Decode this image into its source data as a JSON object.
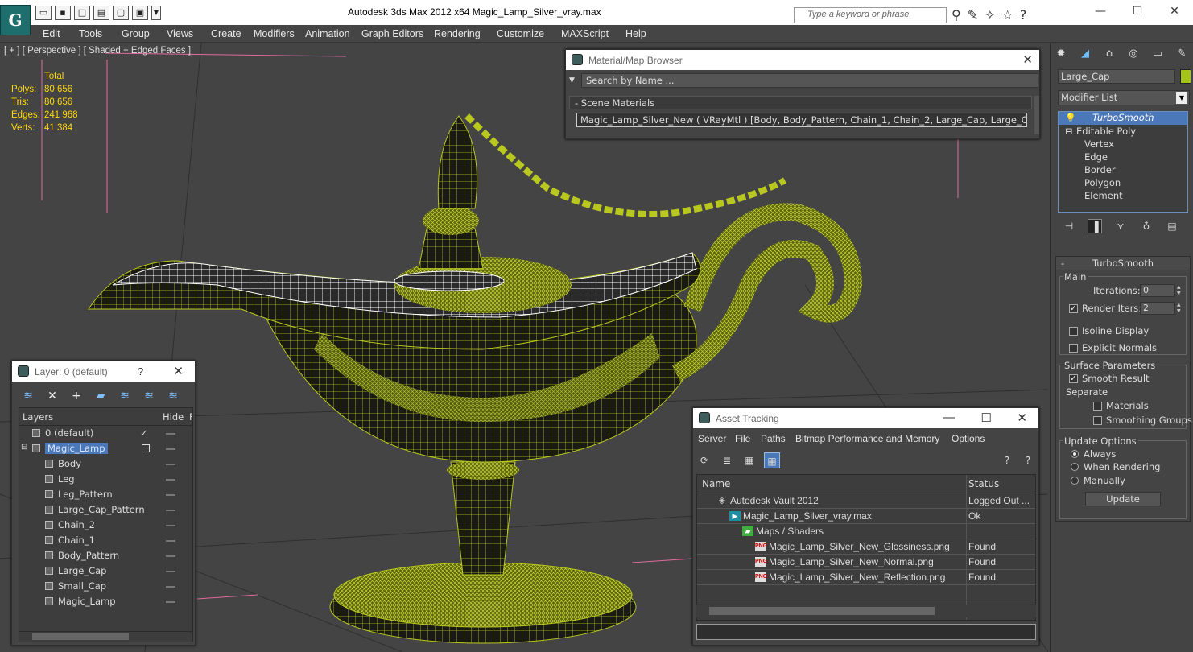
{
  "titlebar": {
    "title": "Autodesk 3ds Max  2012 x64      Magic_Lamp_Silver_vray.max",
    "search_placeholder": "Type a keyword or phrase",
    "logo_letter": "G"
  },
  "menu": [
    "Edit",
    "Tools",
    "Group",
    "Views",
    "Create",
    "Modifiers",
    "Animation",
    "Graph Editors",
    "Rendering",
    "Customize",
    "MAXScript",
    "Help"
  ],
  "viewport": {
    "label": "[ + ] [ Perspective ] [ Shaded + Edged Faces ]",
    "stats_header": "Total",
    "stats": [
      {
        "label": "Polys:",
        "value": "80 656"
      },
      {
        "label": "Tris:",
        "value": "80 656"
      },
      {
        "label": "Edges:",
        "value": "241 968"
      },
      {
        "label": "Verts:",
        "value": "41 384"
      }
    ],
    "wire_color": "#b9c81e"
  },
  "material_browser": {
    "title": "Material/Map Browser",
    "search": "Search by Name ...",
    "section": "- Scene Materials",
    "item": "Magic_Lamp_Silver_New  ( VRayMtl )  [Body, Body_Pattern, Chain_1, Chain_2, Large_Cap, Large_Cap_Patt..."
  },
  "layer_dialog": {
    "title": "Layer: 0 (default)",
    "help": "?",
    "col_layers": "Layers",
    "col_hide": "Hide",
    "col_f": "F",
    "rows": [
      {
        "name": "0 (default)",
        "indent": 0,
        "check": "✓"
      },
      {
        "name": "Magic_Lamp",
        "indent": 0,
        "selected": true
      },
      {
        "name": "Body",
        "indent": 1
      },
      {
        "name": "Leg",
        "indent": 1
      },
      {
        "name": "Leg_Pattern",
        "indent": 1
      },
      {
        "name": "Large_Cap_Pattern",
        "indent": 1
      },
      {
        "name": "Chain_2",
        "indent": 1
      },
      {
        "name": "Chain_1",
        "indent": 1
      },
      {
        "name": "Body_Pattern",
        "indent": 1
      },
      {
        "name": "Large_Cap",
        "indent": 1
      },
      {
        "name": "Small_Cap",
        "indent": 1
      },
      {
        "name": "Magic_Lamp",
        "indent": 1
      }
    ]
  },
  "asset_tracking": {
    "title": "Asset Tracking",
    "menu": [
      "Server",
      "File",
      "Paths",
      "Bitmap Performance and Memory",
      "Options"
    ],
    "col_name": "Name",
    "col_status": "Status",
    "rows": [
      {
        "name": "Autodesk Vault 2012",
        "status": "Logged Out ...",
        "indent": 0,
        "icon": "vault-icon"
      },
      {
        "name": "Magic_Lamp_Silver_vray.max",
        "status": "Ok",
        "indent": 1,
        "icon": "max-file-icon"
      },
      {
        "name": "Maps / Shaders",
        "status": "",
        "indent": 2,
        "icon": "maps-icon"
      },
      {
        "name": "Magic_Lamp_Silver_New_Glossiness.png",
        "status": "Found",
        "indent": 3,
        "icon": "png-icon"
      },
      {
        "name": "Magic_Lamp_Silver_New_Normal.png",
        "status": "Found",
        "indent": 3,
        "icon": "png-icon"
      },
      {
        "name": "Magic_Lamp_Silver_New_Reflection.png",
        "status": "Found",
        "indent": 3,
        "icon": "png-icon"
      }
    ],
    "png_label": "PNG"
  },
  "command_panel": {
    "object_name": "Large_Cap",
    "object_color": "#a4c41a",
    "modifier_list": "Modifier List",
    "stack": [
      "TurboSmooth",
      "Editable Poly",
      "Vertex",
      "Edge",
      "Border",
      "Polygon",
      "Element"
    ],
    "turbosmooth": {
      "title": "TurboSmooth",
      "main": "Main",
      "iterations_label": "Iterations:",
      "iterations": "0",
      "render_iters_label": "Render Iters:",
      "render_iters": "2",
      "isoline": "Isoline Display",
      "explicit_normals": "Explicit Normals",
      "surface_params": "Surface Parameters",
      "smooth_result": "Smooth Result",
      "separate": "Separate",
      "materials": "Materials",
      "smoothing_groups": "Smoothing Groups",
      "update_options": "Update Options",
      "always": "Always",
      "when_rendering": "When Rendering",
      "manually": "Manually",
      "update": "Update"
    }
  }
}
